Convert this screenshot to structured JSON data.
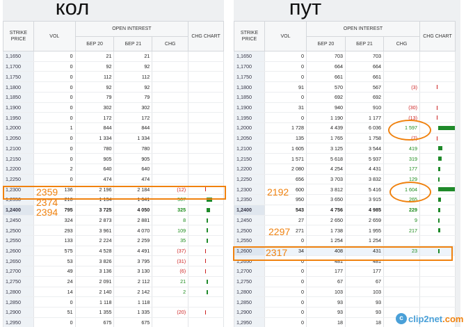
{
  "titles": {
    "calls": "кол",
    "puts": "пут"
  },
  "headers": {
    "strike": "STRIKE PRICE",
    "vol": "VOL",
    "open_interest": "OPEN INTEREST",
    "col_a": "БЕР 20",
    "col_b": "БЕР 21",
    "chg": "CHG",
    "chg_chart": "CHG CHART"
  },
  "calls": [
    {
      "strike": "1,1650",
      "vol": "0",
      "a": "21",
      "b": "21",
      "chg": "",
      "bar": 0
    },
    {
      "strike": "1,1700",
      "vol": "0",
      "a": "92",
      "b": "92",
      "chg": "",
      "bar": 0
    },
    {
      "strike": "1,1750",
      "vol": "0",
      "a": "112",
      "b": "112",
      "chg": "",
      "bar": 0
    },
    {
      "strike": "1,1800",
      "vol": "0",
      "a": "92",
      "b": "92",
      "chg": "",
      "bar": 0
    },
    {
      "strike": "1,1850",
      "vol": "0",
      "a": "79",
      "b": "79",
      "chg": "",
      "bar": 0
    },
    {
      "strike": "1,1900",
      "vol": "0",
      "a": "302",
      "b": "302",
      "chg": "",
      "bar": 0
    },
    {
      "strike": "1,1950",
      "vol": "0",
      "a": "172",
      "b": "172",
      "chg": "",
      "bar": 0
    },
    {
      "strike": "1,2000",
      "vol": "1",
      "a": "844",
      "b": "844",
      "chg": "",
      "bar": 0
    },
    {
      "strike": "1,2050",
      "vol": "0",
      "a": "1 334",
      "b": "1 334",
      "chg": "",
      "bar": 0
    },
    {
      "strike": "1,2100",
      "vol": "0",
      "a": "780",
      "b": "780",
      "chg": "",
      "bar": 0
    },
    {
      "strike": "1,2150",
      "vol": "0",
      "a": "905",
      "b": "905",
      "chg": "",
      "bar": 0
    },
    {
      "strike": "1,2200",
      "vol": "2",
      "a": "640",
      "b": "640",
      "chg": "",
      "bar": 0
    },
    {
      "strike": "1,2250",
      "vol": "0",
      "a": "474",
      "b": "474",
      "chg": "",
      "bar": 0
    },
    {
      "strike": "1,2300",
      "vol": "136",
      "a": "2 196",
      "b": "2 184",
      "chg": "(12)",
      "bar": -12
    },
    {
      "strike": "1,2350",
      "vol": "210",
      "a": "1 134",
      "b": "1 641",
      "chg": "507",
      "bar": 507
    },
    {
      "strike": "1,2400",
      "vol": "795",
      "a": "3 725",
      "b": "4 050",
      "chg": "325",
      "bar": 325,
      "bold": true
    },
    {
      "strike": "1,2450",
      "vol": "324",
      "a": "2 873",
      "b": "2 881",
      "chg": "8",
      "bar": 8
    },
    {
      "strike": "1,2500",
      "vol": "293",
      "a": "3 961",
      "b": "4 070",
      "chg": "109",
      "bar": 109
    },
    {
      "strike": "1,2550",
      "vol": "133",
      "a": "2 224",
      "b": "2 259",
      "chg": "35",
      "bar": 35
    },
    {
      "strike": "1,2600",
      "vol": "575",
      "a": "4 528",
      "b": "4 491",
      "chg": "(37)",
      "bar": -37
    },
    {
      "strike": "1,2650",
      "vol": "53",
      "a": "3 826",
      "b": "3 795",
      "chg": "(31)",
      "bar": -31
    },
    {
      "strike": "1,2700",
      "vol": "49",
      "a": "3 136",
      "b": "3 130",
      "chg": "(6)",
      "bar": -6
    },
    {
      "strike": "1,2750",
      "vol": "24",
      "a": "2 091",
      "b": "2 112",
      "chg": "21",
      "bar": 21
    },
    {
      "strike": "1,2800",
      "vol": "14",
      "a": "2 140",
      "b": "2 142",
      "chg": "2",
      "bar": 2
    },
    {
      "strike": "1,2850",
      "vol": "0",
      "a": "1 118",
      "b": "1 118",
      "chg": "",
      "bar": 0
    },
    {
      "strike": "1,2900",
      "vol": "51",
      "a": "1 355",
      "b": "1 335",
      "chg": "(20)",
      "bar": -20
    },
    {
      "strike": "1,2950",
      "vol": "0",
      "a": "675",
      "b": "675",
      "chg": "",
      "bar": 0
    }
  ],
  "puts": [
    {
      "strike": "1,1650",
      "vol": "0",
      "a": "703",
      "b": "703",
      "chg": "",
      "bar": 0
    },
    {
      "strike": "1,1700",
      "vol": "0",
      "a": "664",
      "b": "664",
      "chg": "",
      "bar": 0
    },
    {
      "strike": "1,1750",
      "vol": "0",
      "a": "661",
      "b": "661",
      "chg": "",
      "bar": 0
    },
    {
      "strike": "1,1800",
      "vol": "91",
      "a": "570",
      "b": "567",
      "chg": "(3)",
      "bar": -3
    },
    {
      "strike": "1,1850",
      "vol": "0",
      "a": "692",
      "b": "692",
      "chg": "",
      "bar": 0
    },
    {
      "strike": "1,1900",
      "vol": "31",
      "a": "940",
      "b": "910",
      "chg": "(30)",
      "bar": -30
    },
    {
      "strike": "1,1950",
      "vol": "0",
      "a": "1 190",
      "b": "1 177",
      "chg": "(13)",
      "bar": -13
    },
    {
      "strike": "1,2000",
      "vol": "1 728",
      "a": "4 439",
      "b": "6 036",
      "chg": "1 597",
      "bar": 1597
    },
    {
      "strike": "1,2050",
      "vol": "135",
      "a": "1 765",
      "b": "1 758",
      "chg": "(7)",
      "bar": -7
    },
    {
      "strike": "1,2100",
      "vol": "1 605",
      "a": "3 125",
      "b": "3 544",
      "chg": "419",
      "bar": 419
    },
    {
      "strike": "1,2150",
      "vol": "1 571",
      "a": "5 618",
      "b": "5 937",
      "chg": "319",
      "bar": 319
    },
    {
      "strike": "1,2200",
      "vol": "2 080",
      "a": "4 254",
      "b": "4 431",
      "chg": "177",
      "bar": 177
    },
    {
      "strike": "1,2250",
      "vol": "656",
      "a": "3 703",
      "b": "3 832",
      "chg": "129",
      "bar": 129
    },
    {
      "strike": "1,2300",
      "vol": "600",
      "a": "3 812",
      "b": "5 416",
      "chg": "1 604",
      "bar": 1604
    },
    {
      "strike": "1,2350",
      "vol": "950",
      "a": "3 650",
      "b": "3 915",
      "chg": "265",
      "bar": 265
    },
    {
      "strike": "1,2400",
      "vol": "543",
      "a": "4 756",
      "b": "4 985",
      "chg": "229",
      "bar": 229,
      "bold": true
    },
    {
      "strike": "1,2450",
      "vol": "27",
      "a": "2 650",
      "b": "2 659",
      "chg": "9",
      "bar": 9
    },
    {
      "strike": "1,2500",
      "vol": "271",
      "a": "1 738",
      "b": "1 955",
      "chg": "217",
      "bar": 217
    },
    {
      "strike": "1,2550",
      "vol": "0",
      "a": "1 254",
      "b": "1 254",
      "chg": "",
      "bar": 0
    },
    {
      "strike": "1,2600",
      "vol": "34",
      "a": "408",
      "b": "431",
      "chg": "23",
      "bar": 23
    },
    {
      "strike": "1,2650",
      "vol": "0",
      "a": "481",
      "b": "481",
      "chg": "",
      "bar": 0
    },
    {
      "strike": "1,2700",
      "vol": "0",
      "a": "177",
      "b": "177",
      "chg": "",
      "bar": 0
    },
    {
      "strike": "1,2750",
      "vol": "0",
      "a": "67",
      "b": "67",
      "chg": "",
      "bar": 0
    },
    {
      "strike": "1,2800",
      "vol": "0",
      "a": "103",
      "b": "103",
      "chg": "",
      "bar": 0
    },
    {
      "strike": "1,2850",
      "vol": "0",
      "a": "93",
      "b": "93",
      "chg": "",
      "bar": 0
    },
    {
      "strike": "1,2900",
      "vol": "0",
      "a": "93",
      "b": "93",
      "chg": "",
      "bar": 0
    },
    {
      "strike": "1,2950",
      "vol": "0",
      "a": "18",
      "b": "18",
      "chg": "",
      "bar": 0
    }
  ],
  "annotations": {
    "call_2300": "2359",
    "call_2350": "2374",
    "call_2400": "2394",
    "put_2300": "2192",
    "put_2500": "2297",
    "put_2600": "2317"
  },
  "watermark": {
    "name": "clip2net",
    "suffix": ".com"
  },
  "colors": {
    "accent": "#f0820f",
    "positive": "#1a8a1a",
    "negative": "#cc2222",
    "bar": "#1f8a2a"
  }
}
